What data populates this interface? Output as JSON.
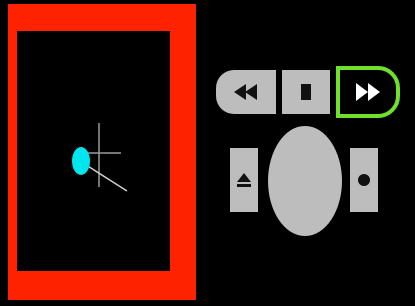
{
  "player": {
    "frame_color": "#ff2200",
    "video_background": "#000000",
    "indicator_color": "#00e5ee",
    "crosshair_color": "#9a9a9a"
  },
  "controls": {
    "button_color": "#bdbdbd",
    "active_button_border": "#6fe02c",
    "icons": {
      "rewind": "rewind-icon",
      "stop": "stop-icon",
      "fast_forward": "fast-forward-icon",
      "eject": "eject-icon",
      "record": "record-icon"
    },
    "active": "fast_forward"
  }
}
